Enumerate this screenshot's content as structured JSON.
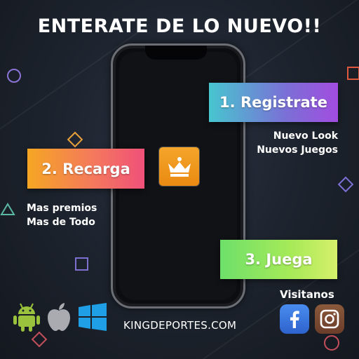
{
  "banner": {
    "headline": "ENTERATE DE LO NUEVO!!",
    "steps": [
      {
        "label": "1. Registrate",
        "caption_lines": [
          "Nuevo Look",
          "Nuevos Juegos"
        ]
      },
      {
        "label": "2. Recarga",
        "caption_lines": [
          "Mas premios",
          "Mas de Todo"
        ]
      },
      {
        "label": "3. Juega"
      }
    ],
    "website": "KINGDEPORTES.COM",
    "visit_label": "Visitanos",
    "platforms": [
      "android-icon",
      "apple-icon",
      "windows-icon"
    ],
    "social": [
      "facebook-icon",
      "instagram-icon"
    ],
    "colors": {
      "background": "#1c222c",
      "card_registrate": [
        "#47c6cf",
        "#a24de0"
      ],
      "card_recarga": [
        "#f5a623",
        "#f0507a"
      ],
      "card_juega": [
        "#6ee06a",
        "#d6f06a"
      ],
      "logo": "#f4a52a"
    }
  }
}
